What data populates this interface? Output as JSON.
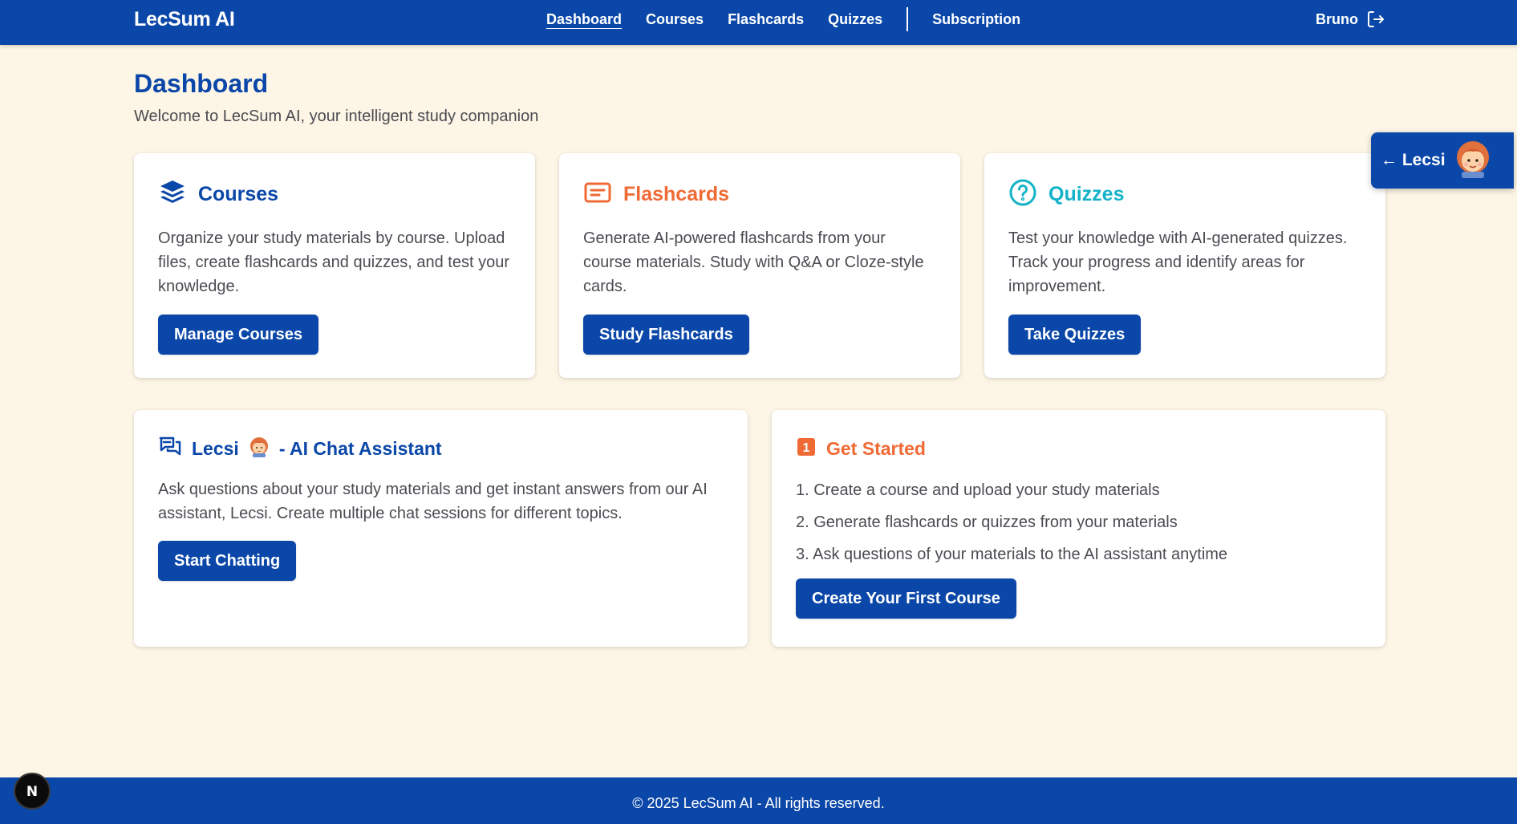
{
  "header": {
    "brand": "LecSum AI",
    "nav": [
      {
        "label": "Dashboard",
        "active": true
      },
      {
        "label": "Courses"
      },
      {
        "label": "Flashcards"
      },
      {
        "label": "Quizzes"
      },
      {
        "label": "Subscription"
      }
    ],
    "user_name": "Bruno",
    "logout_icon": "logout-icon"
  },
  "page": {
    "title": "Dashboard",
    "subtitle": "Welcome to LecSum AI, your intelligent study companion"
  },
  "cards": {
    "courses": {
      "title": "Courses",
      "icon": "layers-icon",
      "color": "#0a47a8",
      "body": "Organize your study materials by course. Upload files, create flashcards and quizzes, and test your knowledge.",
      "button": "Manage Courses"
    },
    "flashcards": {
      "title": "Flashcards",
      "icon": "flashcard-icon",
      "color": "#f06a35",
      "body": "Generate AI-powered flashcards from your course materials. Study with Q&A or Cloze-style cards.",
      "button": "Study Flashcards"
    },
    "quizzes": {
      "title": "Quizzes",
      "icon": "question-circle-icon",
      "color": "#14b3c8",
      "body": "Test your knowledge with AI-generated quizzes. Track your progress and identify areas for improvement.",
      "button": "Take Quizzes"
    },
    "chat": {
      "title_prefix": "Lecsi",
      "title_suffix": "- AI Chat Assistant",
      "icon": "chat-icon",
      "body": "Ask questions about your study materials and get instant answers from our AI assistant, Lecsi. Create multiple chat sessions for different topics.",
      "button": "Start Chatting"
    },
    "get_started": {
      "title": "Get Started",
      "icon": "number-one-icon",
      "badge": "1",
      "steps": [
        "1. Create a course and upload your study materials",
        "2. Generate flashcards or quizzes from your materials",
        "3. Ask questions of your materials to the AI assistant anytime"
      ],
      "button": "Create Your First Course"
    }
  },
  "lecsi_tab": {
    "label": "← Lecsi",
    "avatar": "lecsi-avatar-icon"
  },
  "footer": {
    "text": "© 2025 LecSum AI - All rights reserved."
  },
  "dev_badge": {
    "label": "N"
  },
  "colors": {
    "primary": "#0a47a8",
    "orange": "#f06a35",
    "teal": "#14b3c8",
    "background": "#fdf6e6"
  }
}
